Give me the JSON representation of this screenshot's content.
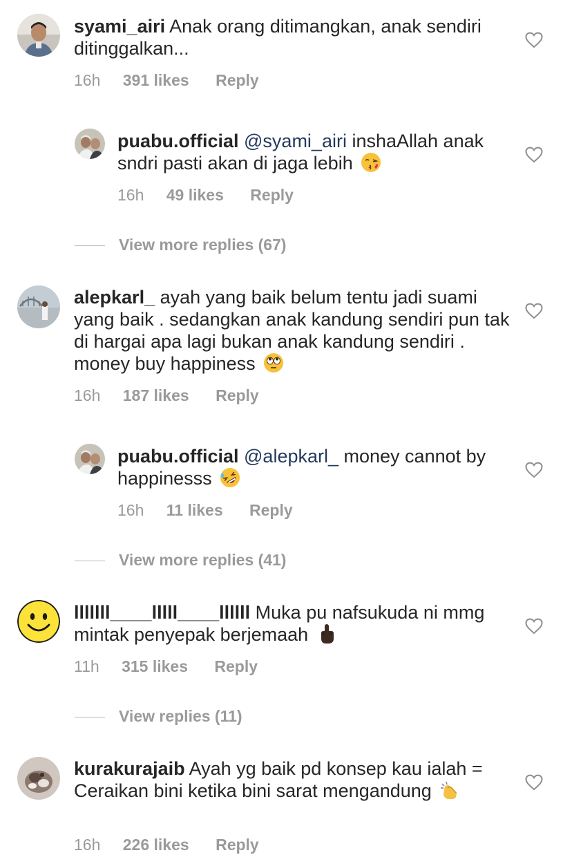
{
  "comments": [
    {
      "username": "syami_airi",
      "text": "Anak orang ditimangkan,  anak sendiri ditinggalkan...",
      "time": "16h",
      "likes": "391 likes",
      "reply": "Reply",
      "replies": [
        {
          "username": "puabu.official",
          "mention": "@syami_airi",
          "text": "inshaAllah anak sndri pasti akan di jaga lebih",
          "emoji": "kissing-face-emoji",
          "time": "16h",
          "likes": "49 likes",
          "reply": "Reply"
        }
      ],
      "view_more": "View more replies (67)"
    },
    {
      "username": "alepkarl_",
      "text": "ayah yang baik belum tentu jadi suami yang baik . sedangkan anak kandung sendiri pun tak di hargai apa lagi bukan anak kandung sendiri . money buy happiness",
      "emoji": "eye-roll-emoji",
      "time": "16h",
      "likes": "187 likes",
      "reply": "Reply",
      "replies": [
        {
          "username": "puabu.official",
          "mention": "@alepkarl_",
          "text": "money cannot by happinesss",
          "emoji": "rofl-emoji",
          "time": "16h",
          "likes": "11 likes",
          "reply": "Reply"
        }
      ],
      "view_more": "View more replies (41)"
    },
    {
      "username": "lllllll____lllll____llllll",
      "text": "Muka pu nafsukuda ni mmg mintak penyepak berjemaah",
      "emoji": "middle-finger-emoji",
      "time": "11h",
      "likes": "315 likes",
      "reply": "Reply",
      "view_more": "View replies (11)"
    },
    {
      "username": "kurakurajaib",
      "text": "Ayah yg baik pd konsep kau ialah = Ceraikan bini ketika bini sarat mengandung",
      "emoji": "clapping-hands-emoji",
      "time": "16h",
      "likes": "226 likes",
      "reply": "Reply"
    }
  ],
  "colors": {
    "text": "#262626",
    "meta": "#9a9a9a",
    "mention": "#23395d"
  }
}
